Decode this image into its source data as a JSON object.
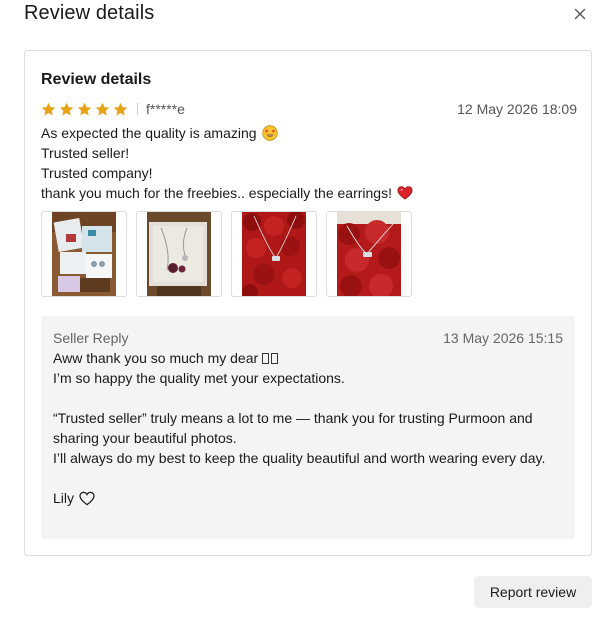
{
  "modal": {
    "title": "Review details",
    "close_icon": "close-icon"
  },
  "review": {
    "section_title": "Review details",
    "rating": 5,
    "rating_max": 5,
    "star_color": "#E8A317",
    "reviewer": "f*****e",
    "date": "12 May 2026 18:09",
    "lines": [
      "As expected the quality is amazing",
      "Trusted seller!",
      "Trusted company!",
      "thank you much for the freebies.. especially the earrings!"
    ],
    "line_emojis": [
      "star-struck-emoji",
      "",
      "",
      "red-heart-emoji"
    ],
    "photos": [
      {
        "name": "review-photo-1"
      },
      {
        "name": "review-photo-2"
      },
      {
        "name": "review-photo-3"
      },
      {
        "name": "review-photo-4"
      }
    ]
  },
  "reply": {
    "label": "Seller Reply",
    "date": "13 May 2026 15:15",
    "line1": "Aww thank you so much my dear",
    "line2": "I’m so happy the quality met your expectations.",
    "line3": "“Trusted seller” truly means a lot to me — thank you for trusting Purmoon and sharing your beautiful photos.",
    "line4": "I’ll always do my best to keep the quality beautiful and worth wearing every day.",
    "signature": "Lily",
    "signature_icon": "heart-outline-icon"
  },
  "actions": {
    "report_label": "Report review"
  }
}
